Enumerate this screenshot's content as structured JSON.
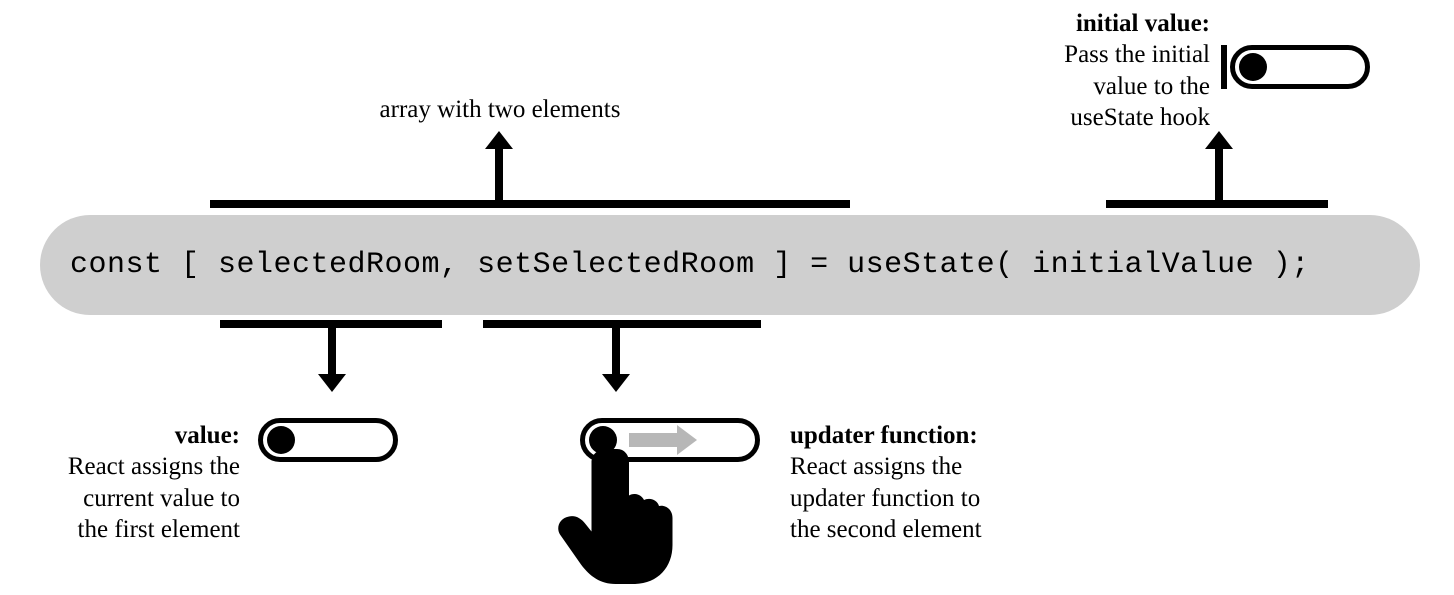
{
  "code_line": "const [ selectedRoom, setSelectedRoom ] = useState( initialValue );",
  "annotations": {
    "array_label": "array with two elements",
    "initial": {
      "title": "initial value:",
      "desc_l1": "Pass the initial",
      "desc_l2": "value to the",
      "desc_l3": "useState hook"
    },
    "value": {
      "title": "value:",
      "desc_l1": "React assigns the",
      "desc_l2": "current value to",
      "desc_l3": "the first element"
    },
    "updater": {
      "title": "updater function:",
      "desc_l1": "React assigns the",
      "desc_l2": "updater function to",
      "desc_l3": "the second element"
    }
  }
}
